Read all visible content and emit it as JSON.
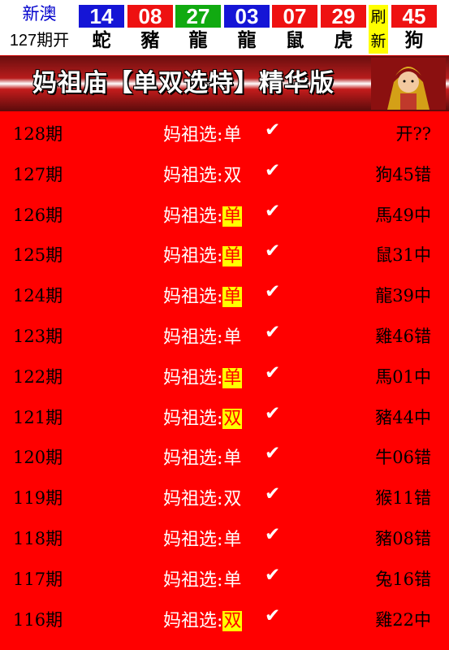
{
  "header": {
    "lottery_name": "新澳",
    "period_label": "127期开",
    "balls": [
      {
        "number": "14",
        "zodiac": "蛇",
        "color": "#1515d6"
      },
      {
        "number": "08",
        "zodiac": "豬",
        "color": "#ee1111"
      },
      {
        "number": "27",
        "zodiac": "龍",
        "color": "#11aa11"
      },
      {
        "number": "03",
        "zodiac": "龍",
        "color": "#1515d6"
      },
      {
        "number": "07",
        "zodiac": "鼠",
        "color": "#ee1111"
      },
      {
        "number": "29",
        "zodiac": "虎",
        "color": "#ee1111"
      }
    ],
    "refresh_top": "刷",
    "refresh_bottom": "新",
    "special_ball": {
      "number": "45",
      "zodiac": "狗",
      "color": "#ee1111"
    }
  },
  "banner": {
    "title": "妈祖庙【单双选特】精华版"
  },
  "pick_prefix": "妈祖选:",
  "check_mark": "✔",
  "rows": [
    {
      "period": "128期",
      "pick": "单",
      "highlight": false,
      "result": "开??"
    },
    {
      "period": "127期",
      "pick": "双",
      "highlight": false,
      "result": "狗45错"
    },
    {
      "period": "126期",
      "pick": "单",
      "highlight": true,
      "result": "馬49中"
    },
    {
      "period": "125期",
      "pick": "单",
      "highlight": true,
      "result": "鼠31中"
    },
    {
      "period": "124期",
      "pick": "单",
      "highlight": true,
      "result": "龍39中"
    },
    {
      "period": "123期",
      "pick": "单",
      "highlight": false,
      "result": "雞46错"
    },
    {
      "period": "122期",
      "pick": "单",
      "highlight": true,
      "result": "馬01中"
    },
    {
      "period": "121期",
      "pick": "双",
      "highlight": true,
      "result": "豬44中"
    },
    {
      "period": "120期",
      "pick": "单",
      "highlight": false,
      "result": "牛06错"
    },
    {
      "period": "119期",
      "pick": "双",
      "highlight": false,
      "result": "猴11错"
    },
    {
      "period": "118期",
      "pick": "单",
      "highlight": false,
      "result": "豬08错"
    },
    {
      "period": "117期",
      "pick": "单",
      "highlight": false,
      "result": "兔16错"
    },
    {
      "period": "116期",
      "pick": "双",
      "highlight": true,
      "result": "雞22中"
    }
  ]
}
